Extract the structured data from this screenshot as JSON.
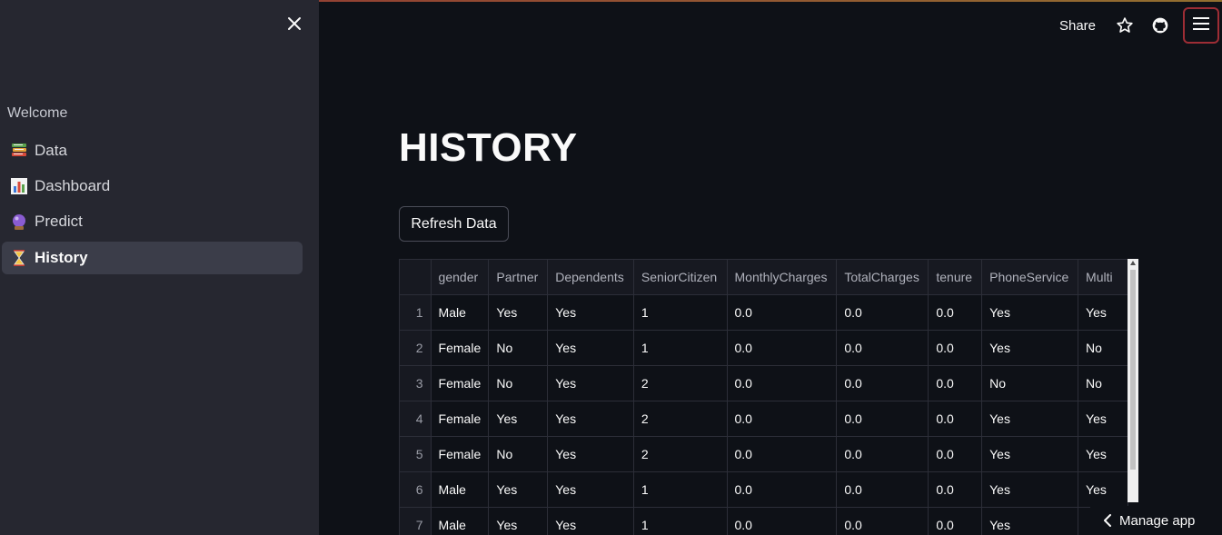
{
  "sidebar": {
    "welcome": "Welcome",
    "items": [
      {
        "label": "Data",
        "icon": "books-icon"
      },
      {
        "label": "Dashboard",
        "icon": "bar-chart-icon"
      },
      {
        "label": "Predict",
        "icon": "crystal-ball-icon"
      },
      {
        "label": "History",
        "icon": "hourglass-icon",
        "active": true
      }
    ]
  },
  "header": {
    "share_label": "Share"
  },
  "main": {
    "title": "HISTORY",
    "refresh_label": "Refresh Data"
  },
  "table": {
    "columns": [
      "gender",
      "Partner",
      "Dependents",
      "SeniorCitizen",
      "MonthlyCharges",
      "TotalCharges",
      "tenure",
      "PhoneService",
      "Multi"
    ],
    "rows": [
      {
        "index": "1",
        "cells": [
          "Male",
          "Yes",
          "Yes",
          "1",
          "0.0",
          "0.0",
          "0.0",
          "Yes",
          "Yes"
        ]
      },
      {
        "index": "2",
        "cells": [
          "Female",
          "No",
          "Yes",
          "1",
          "0.0",
          "0.0",
          "0.0",
          "Yes",
          "No"
        ]
      },
      {
        "index": "3",
        "cells": [
          "Female",
          "No",
          "Yes",
          "2",
          "0.0",
          "0.0",
          "0.0",
          "No",
          "No"
        ]
      },
      {
        "index": "4",
        "cells": [
          "Female",
          "Yes",
          "Yes",
          "2",
          "0.0",
          "0.0",
          "0.0",
          "Yes",
          "Yes"
        ]
      },
      {
        "index": "5",
        "cells": [
          "Female",
          "No",
          "Yes",
          "2",
          "0.0",
          "0.0",
          "0.0",
          "Yes",
          "Yes"
        ]
      },
      {
        "index": "6",
        "cells": [
          "Male",
          "Yes",
          "Yes",
          "1",
          "0.0",
          "0.0",
          "0.0",
          "Yes",
          "Yes"
        ]
      },
      {
        "index": "7",
        "cells": [
          "Male",
          "Yes",
          "Yes",
          "1",
          "0.0",
          "0.0",
          "0.0",
          "Yes",
          ""
        ]
      }
    ]
  },
  "footer": {
    "manage_label": "Manage app"
  },
  "colors": {
    "background": "#0e1117",
    "sidebar": "#262730",
    "active_item": "#3b3d49",
    "menu_border": "#9d2d35"
  }
}
